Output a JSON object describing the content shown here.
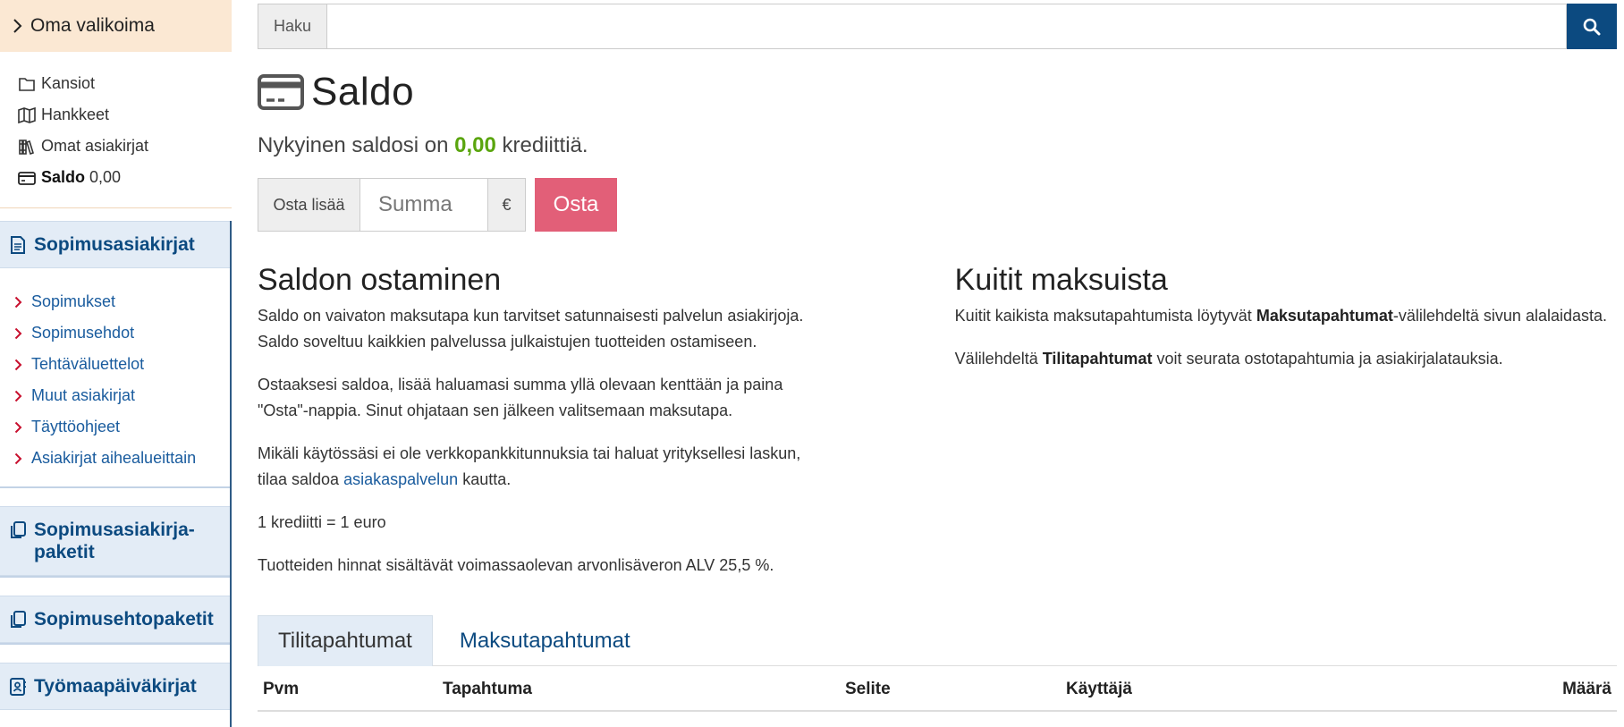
{
  "sidebar": {
    "own": {
      "title": "Oma valikoima",
      "items": [
        {
          "icon": "folder-icon",
          "label": "Kansiot"
        },
        {
          "icon": "map-icon",
          "label": "Hankkeet"
        },
        {
          "icon": "books-icon",
          "label": "Omat asiakirjat"
        }
      ],
      "balance_label": "Saldo",
      "balance_value": "0,00"
    },
    "contracts": {
      "title": "Sopimusasiakirjat",
      "items": [
        "Sopimukset",
        "Sopimusehdot",
        "Tehtäväluettelot",
        "Muut asiakirjat",
        "Täyttöohjeet",
        "Asiakirjat aihealueittain"
      ]
    },
    "packages": "Sopimusasiakirja-\npaketit",
    "term_packages": "Sopimusehtopaketit",
    "site_diaries": "Työmaapäiväkirjat"
  },
  "search": {
    "label": "Haku",
    "value": ""
  },
  "page": {
    "title": "Saldo",
    "balance_prefix": "Nykyinen saldosi on",
    "balance_amount": "0,00",
    "balance_suffix": "krediittiä."
  },
  "buy": {
    "label": "Osta lisää",
    "placeholder": "Summa",
    "currency": "€",
    "button": "Osta"
  },
  "left_col": {
    "heading": "Saldon ostaminen",
    "p1": "Saldo on vaivaton maksutapa kun tarvitset satunnaisesti palvelun asiakirjoja. Saldo soveltuu kaikkien palvelussa julkaistujen tuotteiden ostamiseen.",
    "p2": "Ostaaksesi saldoa, lisää haluamasi summa yllä olevaan kenttään ja paina \"Osta\"-nappia. Sinut ohjataan sen jälkeen valitsemaan maksutapa.",
    "p3_before": "Mikäli käytössäsi ei ole verkkopankkitunnuksia tai haluat yrityksellesi laskun, tilaa saldoa",
    "p3_link": "asiakaspalvelun",
    "p3_after": "kautta.",
    "p4": "1 krediitti = 1 euro",
    "p5": "Tuotteiden hinnat sisältävät voimassaolevan arvonlisäveron ALV 25,5 %."
  },
  "right_col": {
    "heading": "Kuitit maksuista",
    "p1_before": "Kuitit kaikista maksutapahtumista löytyvät",
    "p1_bold": "Maksutapahtumat",
    "p1_after": "-välilehdeltä sivun alalaidasta.",
    "p2_before": "Välilehdeltä",
    "p2_bold": "Tilitapahtumat",
    "p2_after": "voit seurata ostotapahtumia ja asiakirjalatauksia."
  },
  "tabs": [
    {
      "label": "Tilitapahtumat",
      "active": true
    },
    {
      "label": "Maksutapahtumat",
      "active": false
    }
  ],
  "table": {
    "columns": [
      "Pvm",
      "Tapahtuma",
      "Selite",
      "Käyttäjä",
      "Määrä"
    ]
  },
  "colors": {
    "accent": "#0c4a80",
    "buy_button": "#e25f78",
    "balance_green": "#5aa50e",
    "own_header_bg": "#fbe8d3",
    "section_bg": "#e3ecf6"
  }
}
